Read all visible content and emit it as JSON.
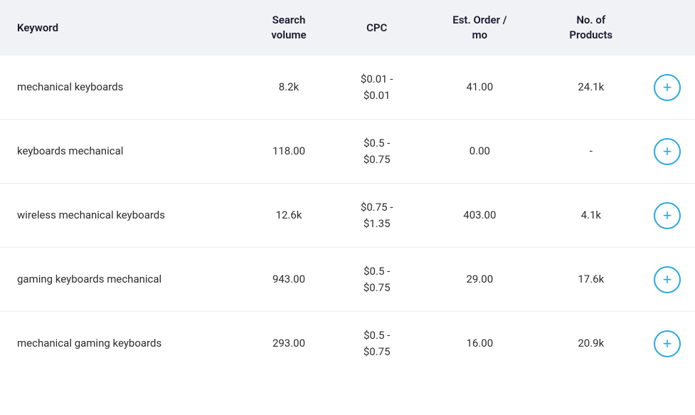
{
  "table": {
    "headers": [
      {
        "id": "keyword",
        "label": "Keyword"
      },
      {
        "id": "search-volume",
        "label": "Search\nvolume"
      },
      {
        "id": "cpc",
        "label": "CPC"
      },
      {
        "id": "est-order",
        "label": "Est. Order /\nmo"
      },
      {
        "id": "no-products",
        "label": "No. of\nProducts"
      },
      {
        "id": "action",
        "label": ""
      }
    ],
    "rows": [
      {
        "keyword": "mechanical keyboards",
        "search_volume": "8.2k",
        "cpc": "$0.01 -\n$0.01",
        "est_order": "41.00",
        "no_products": "24.1k",
        "btn_label": "+"
      },
      {
        "keyword": "keyboards mechanical",
        "search_volume": "118.00",
        "cpc": "$0.5 -\n$0.75",
        "est_order": "0.00",
        "no_products": "-",
        "btn_label": "+"
      },
      {
        "keyword": "wireless mechanical keyboards",
        "search_volume": "12.6k",
        "cpc": "$0.75 -\n$1.35",
        "est_order": "403.00",
        "no_products": "4.1k",
        "btn_label": "+"
      },
      {
        "keyword": "gaming keyboards mechanical",
        "search_volume": "943.00",
        "cpc": "$0.5 -\n$0.75",
        "est_order": "29.00",
        "no_products": "17.6k",
        "btn_label": "+"
      },
      {
        "keyword": "mechanical gaming keyboards",
        "search_volume": "293.00",
        "cpc": "$0.5 -\n$0.75",
        "est_order": "16.00",
        "no_products": "20.9k",
        "btn_label": "+"
      }
    ]
  }
}
